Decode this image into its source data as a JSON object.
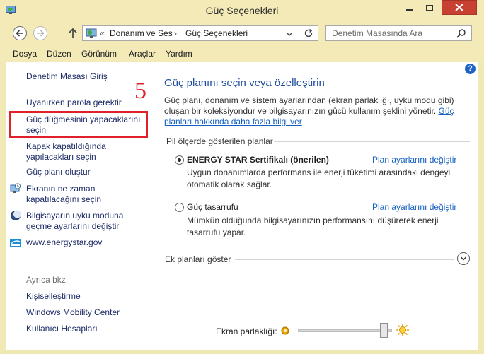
{
  "window": {
    "title": "Güç Seçenekleri"
  },
  "address_bar": {
    "overflow": "«",
    "crumbs": [
      "Donanım ve Ses",
      "Güç Seçenekleri"
    ],
    "separator": "›"
  },
  "search": {
    "placeholder": "Denetim Masasında Ara"
  },
  "menu": {
    "items": [
      "Dosya",
      "Düzen",
      "Görünüm",
      "Araçlar",
      "Yardım"
    ]
  },
  "sidebar": {
    "home": "Denetim Masası Giriş",
    "tasks": [
      {
        "label": "Uyanırken parola gerektir"
      },
      {
        "label_lines": [
          "Güç düğmesinin yapacaklarını",
          "seçin"
        ]
      },
      {
        "label_lines": [
          "Kapak kapatıldığında",
          "yapılacakları seçin"
        ]
      },
      {
        "label": "Güç planı oluştur"
      },
      {
        "label_lines": [
          "Ekranın ne zaman",
          "kapatılacağını seçin"
        ],
        "icon": "monitor-clock-icon"
      },
      {
        "label_lines": [
          "Bilgisayarın uyku moduna",
          "geçme ayarlarını değiştir"
        ],
        "icon": "moon-icon"
      },
      {
        "label": "www.energystar.gov",
        "icon": "energy-star-icon"
      }
    ],
    "see_also_title": "Ayrıca bkz.",
    "see_also": [
      "Kişiselleştirme",
      "Windows Mobility Center",
      "Kullanıcı Hesapları"
    ]
  },
  "annotation": {
    "step_number": "5",
    "color": "#e0202a"
  },
  "main": {
    "heading": "Güç planını seçin veya özelleştirin",
    "description_lines": [
      "Güç planı, donanım ve sistem ayarlarından (ekran parlaklığı, uyku modu gibi)",
      "oluşan bir koleksiyondur ve bilgisayarınızın gücü kullanım şeklini yönetir."
    ],
    "description_link_part1": "Güç",
    "description_link_part2": "planları hakkında daha fazla bilgi ver",
    "section_title": "Pil ölçerde gösterilen planlar",
    "plans": [
      {
        "name": "ENERGY STAR Sertifikalı (önerilen)",
        "selected": true,
        "link": "Plan ayarlarını değiştir",
        "desc_lines": [
          "Uygun donanımlarda performans ile enerji tüketimi arasındaki dengeyi",
          "otomatik olarak sağlar."
        ]
      },
      {
        "name": "Güç tasarrufu",
        "selected": false,
        "link": "Plan ayarlarını değiştir",
        "desc_lines": [
          "Mümkün olduğunda bilgisayarınızın performansını düşürerek enerji",
          "tasarrufu yapar."
        ]
      }
    ],
    "more_plans": "Ek planları göster",
    "brightness_label": "Ekran parlaklığı:",
    "brightness_level": 0.95
  },
  "colors": {
    "frame": "#f3eab8",
    "link": "#1d2b66",
    "heading": "#1f4e9e",
    "accent_link": "#1460c0",
    "close": "#c84031"
  }
}
